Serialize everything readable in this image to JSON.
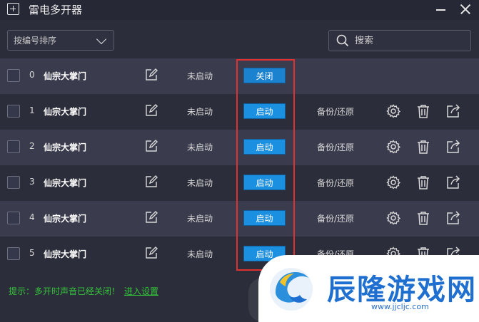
{
  "window": {
    "title": "雷电多开器"
  },
  "toolbar": {
    "sort_label": "按编号排序",
    "search_placeholder": "搜索"
  },
  "rows": [
    {
      "index": "0",
      "name": "仙宗大掌门",
      "status": "未启动",
      "action": "关闭",
      "backup": ""
    },
    {
      "index": "1",
      "name": "仙宗大掌门",
      "status": "未启动",
      "action": "启动",
      "backup": "备份/还原"
    },
    {
      "index": "2",
      "name": "仙宗大掌门",
      "status": "未启动",
      "action": "启动",
      "backup": "备份/还原"
    },
    {
      "index": "3",
      "name": "仙宗大掌门",
      "status": "未启动",
      "action": "启动",
      "backup": "备份/还原"
    },
    {
      "index": "4",
      "name": "仙宗大掌门",
      "status": "未启动",
      "action": "启动",
      "backup": "备份/还原"
    },
    {
      "index": "5",
      "name": "仙宗大掌门",
      "status": "未启动",
      "action": "启动",
      "backup": "备份/还原"
    }
  ],
  "footer": {
    "hint": "提示：多开时声音已经关闭！",
    "settings_link": "进入设置"
  },
  "watermark": {
    "title": "辰隆游戏网",
    "url": "www.jjcljc.com"
  },
  "colors": {
    "background": "#2b2d3a",
    "row_light": "#3a3c4e",
    "accent_button": "#1b8fe0",
    "highlight_border": "#e03030",
    "hint_text": "#35c43a"
  },
  "icons": [
    "app-add-icon",
    "minimize-icon",
    "close-icon",
    "chevron-down-icon",
    "search-icon",
    "edit-icon",
    "gear-icon",
    "trash-icon",
    "share-icon"
  ]
}
